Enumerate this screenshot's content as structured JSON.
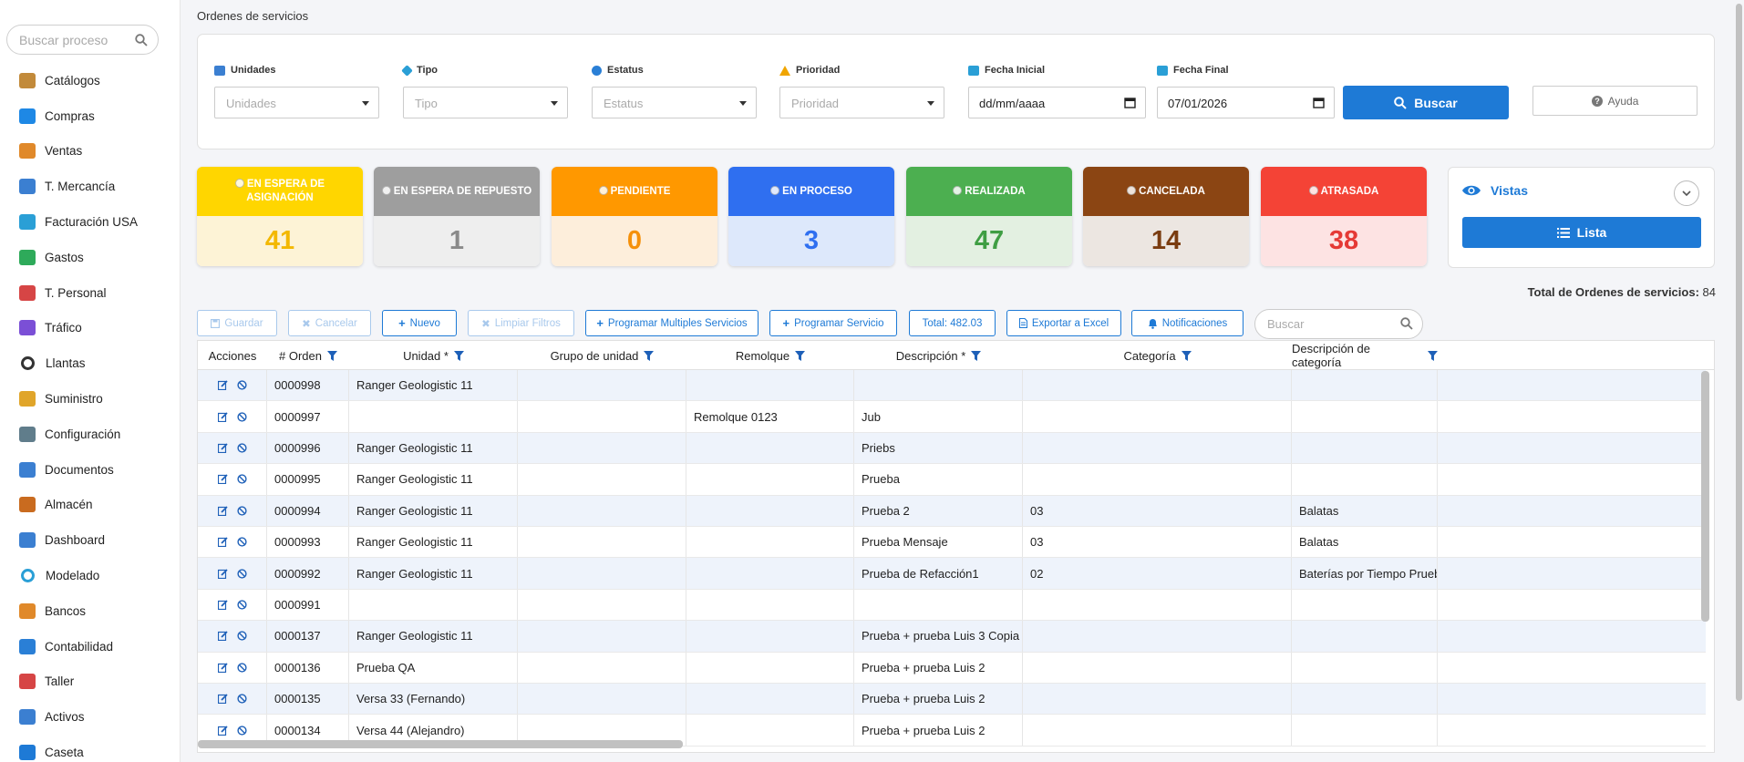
{
  "sidebar": {
    "search_placeholder": "Buscar proceso",
    "items": [
      {
        "label": "Catálogos",
        "icon": "catalog-icon",
        "color": "#c28a3a"
      },
      {
        "label": "Compras",
        "icon": "cart-icon",
        "color": "#1e88e5"
      },
      {
        "label": "Ventas",
        "icon": "handshake-icon",
        "color": "#e0892a"
      },
      {
        "label": "T. Mercancía",
        "icon": "truck-icon",
        "color": "#3b7fd1"
      },
      {
        "label": "Facturación USA",
        "icon": "invoice-icon",
        "color": "#2a9fd6"
      },
      {
        "label": "Gastos",
        "icon": "money-icon",
        "color": "#2eaa5a"
      },
      {
        "label": "T. Personal",
        "icon": "bus-icon",
        "color": "#d64545"
      },
      {
        "label": "Tráfico",
        "icon": "traffic-icon",
        "color": "#7b4fd6"
      },
      {
        "label": "Llantas",
        "icon": "tire-icon",
        "color": "#333333"
      },
      {
        "label": "Suministro",
        "icon": "fuel-icon",
        "color": "#e0a52a"
      },
      {
        "label": "Configuración",
        "icon": "gear-icon",
        "color": "#607d8b"
      },
      {
        "label": "Documentos",
        "icon": "document-icon",
        "color": "#3b7fd1"
      },
      {
        "label": "Almacén",
        "icon": "warehouse-icon",
        "color": "#c96b1f"
      },
      {
        "label": "Dashboard",
        "icon": "dashboard-icon",
        "color": "#3b7fd1"
      },
      {
        "label": "Modelado",
        "icon": "modeling-icon",
        "color": "#2a9fd6"
      },
      {
        "label": "Bancos",
        "icon": "bank-icon",
        "color": "#e0892a"
      },
      {
        "label": "Contabilidad",
        "icon": "accounting-icon",
        "color": "#2a7fd6"
      },
      {
        "label": "Taller",
        "icon": "tools-icon",
        "color": "#d64545"
      },
      {
        "label": "Activos",
        "icon": "assets-icon",
        "color": "#3b7fd1"
      },
      {
        "label": "Caseta",
        "icon": "tollbooth-icon",
        "color": "#1e7ad6"
      }
    ]
  },
  "page": {
    "title": "Ordenes de servicios"
  },
  "filters": {
    "unidades": {
      "label": "Unidades",
      "placeholder": "Unidades"
    },
    "tipo": {
      "label": "Tipo",
      "placeholder": "Tipo"
    },
    "estatus": {
      "label": "Estatus",
      "placeholder": "Estatus"
    },
    "prioridad": {
      "label": "Prioridad",
      "placeholder": "Prioridad"
    },
    "fecha_inicial": {
      "label": "Fecha Inicial",
      "value": "dd/mm/aaaa"
    },
    "fecha_final": {
      "label": "Fecha Final",
      "value": "07/01/2026"
    },
    "buscar_label": "Buscar",
    "ayuda_label": "Ayuda"
  },
  "status_cards": [
    {
      "title": "EN ESPERA DE ASIGNACIÓN",
      "count": "41",
      "head_color": "#ffd600",
      "body_color": "#fdf3d6",
      "num_color": "#f3b800"
    },
    {
      "title": "EN ESPERA DE REPUESTO",
      "count": "1",
      "head_color": "#9e9e9e",
      "body_color": "#eeeeee",
      "num_color": "#8a8a8a"
    },
    {
      "title": "PENDIENTE",
      "count": "0",
      "head_color": "#ff9800",
      "body_color": "#fdeedb",
      "num_color": "#f5900a"
    },
    {
      "title": "EN PROCESO",
      "count": "3",
      "head_color": "#2f6ff0",
      "body_color": "#dde8fb",
      "num_color": "#2f6ff0"
    },
    {
      "title": "REALIZADA",
      "count": "47",
      "head_color": "#4caf50",
      "body_color": "#e3f0e1",
      "num_color": "#3f9e43"
    },
    {
      "title": "CANCELADA",
      "count": "14",
      "head_color": "#8b4513",
      "body_color": "#ece6e1",
      "num_color": "#7a3c10"
    },
    {
      "title": "ATRASADA",
      "count": "38",
      "head_color": "#f44336",
      "body_color": "#fde3e3",
      "num_color": "#e53935"
    }
  ],
  "vistas": {
    "title": "Vistas",
    "lista_label": "Lista"
  },
  "totals": {
    "label": "Total de Ordenes de servicios:",
    "value": "84"
  },
  "toolbar": {
    "guardar": "Guardar",
    "cancelar": "Cancelar",
    "nuevo": "Nuevo",
    "limpiar": "Limpiar Filtros",
    "programar_multiples": "Programar Multiples Servicios",
    "programar": "Programar Servicio",
    "total": "Total: 482.03",
    "exportar": "Exportar a Excel",
    "notificaciones": "Notificaciones",
    "search_placeholder": "Buscar"
  },
  "table": {
    "headers": [
      "Acciones",
      "# Orden",
      "Unidad *",
      "Grupo de unidad",
      "Remolque",
      "Descripción *",
      "Categoría",
      "Descripción de categoría"
    ],
    "rows": [
      [
        "0000998",
        "Ranger Geologistic 11",
        "",
        "",
        "",
        "",
        ""
      ],
      [
        "0000997",
        "",
        "",
        "Remolque 0123",
        "Jub",
        "",
        ""
      ],
      [
        "0000996",
        "Ranger Geologistic 11",
        "",
        "",
        "Priebs",
        "",
        ""
      ],
      [
        "0000995",
        "Ranger Geologistic 11",
        "",
        "",
        "Prueba",
        "",
        ""
      ],
      [
        "0000994",
        "Ranger Geologistic 11",
        "",
        "",
        "Prueba 2",
        "03",
        "Balatas"
      ],
      [
        "0000993",
        "Ranger Geologistic 11",
        "",
        "",
        "Prueba Mensaje",
        "03",
        "Balatas"
      ],
      [
        "0000992",
        "Ranger Geologistic 11",
        "",
        "",
        "Prueba de Refacción1",
        "02",
        "Baterías por Tiempo Prueba"
      ],
      [
        "0000991",
        "",
        "",
        "",
        "",
        "",
        ""
      ],
      [
        "0000137",
        "Ranger Geologistic 11",
        "",
        "",
        "Prueba + prueba Luis 3 Copia",
        "",
        ""
      ],
      [
        "0000136",
        "Prueba QA",
        "",
        "",
        "Prueba + prueba Luis 2",
        "",
        ""
      ],
      [
        "0000135",
        "Versa 33 (Fernando)",
        "",
        "",
        "Prueba + prueba Luis 2",
        "",
        ""
      ],
      [
        "0000134",
        "Versa 44 (Alejandro)",
        "",
        "",
        "Prueba + prueba Luis 2",
        "",
        ""
      ]
    ]
  }
}
